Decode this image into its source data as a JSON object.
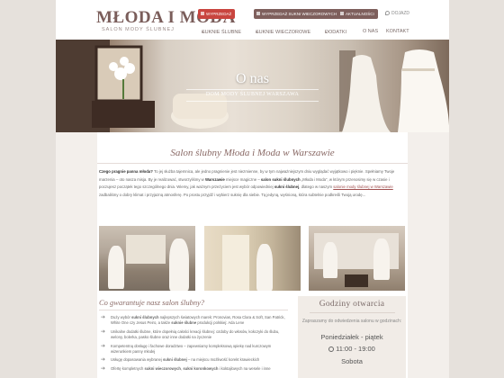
{
  "header": {
    "logo": "MŁODA I MODA",
    "tagline": "SALON MODY ŚLUBNEJ",
    "btn_sale": "WYPRZEDAŻ",
    "btn_evening_sale": "WYPRZEDAŻ SUKNI WIECZOROWYCH",
    "btn_news": "AKTUALNOŚCI",
    "location": "DOJAZD"
  },
  "nav": {
    "items": [
      {
        "label": "SUKNIE ŚLUBNE"
      },
      {
        "label": "SUKNIE WIECZOROWE"
      },
      {
        "label": "DODATKI"
      },
      {
        "label": "O NAS"
      },
      {
        "label": "KONTAKT"
      }
    ]
  },
  "hero": {
    "title": "O nas",
    "subtitle": "DOM MODY ŚLUBNEJ WARSZAWA"
  },
  "main": {
    "heading": "Salon ślubny Młoda i Moda w Warszawie",
    "paragraph": {
      "q": "Czego pragnie panna młoda?",
      "p1": " To jej służba tajemnica, ale jedno pragnienie jest niezmienne, by w tym najważniejszym dniu wyglądać wyjątkowo i pięknie. Spełniamy Twoje marzenia – oto nasza misja. By je realizować, stworzyliśmy w ",
      "warszawa": "Warszawie",
      "p2": " miejsce magiczne – ",
      "salon": "salon sukni ślubnych",
      "p3": " „Młoda i Moda”, w którym przenosimy się w czasie i poczujesz początek tego szczególnego dnia. Wiemy, jak ważnym przeżyciem jest wybór odpowiedniej ",
      "suknia": "sukni ślubnej",
      "p4": ", dlatego w naszym ",
      "link": "salonie mody ślubnej w Warszawie",
      "p5": " zadbaliśmy o dobry klimat i przyjazną atmosferę. Po prostu przyjdź i wybierz suknię dla siebie. Tą jedyną, wyśnioną, która subtelnie podkreśli Twoją urodę..."
    }
  },
  "guarantee": {
    "heading": "Co gwarantuje nasz salon ślubny?",
    "bullets": [
      {
        "a": "Duży wybór ",
        "b": "sukni ślubnych",
        "c": " najlepszych światowych marek: Pronovias, Rosa Clara & Soft, San Patrick, White One czy Jesus Peiro, a także ",
        "d": "suknie ślubne",
        "e": " produkcji polskiej: Ada Lene"
      },
      {
        "a": "Unikalne dodatki ślubne, które dopełnią całości kreacji ślubnej: ozdoby do włosów, kokczyki do ślubu, welony, bolerka, pasko ślubne oraz inne dodatki na życzenie",
        "b": "",
        "c": "",
        "d": "",
        "e": ""
      },
      {
        "a": "Kompetentną obsługę i fachowe doradztwo – zapewniamy kompleksową opiekę nad kurczowym wizerunkiem panny młodej",
        "b": "",
        "c": "",
        "d": "",
        "e": ""
      },
      {
        "a": "Usługę dopasowania wybranej ",
        "b": "sukni ślubnej",
        "c": " – na miejscu możliwość korekt krawieckich",
        "d": "",
        "e": ""
      },
      {
        "a": "Ofertę kompletnych ",
        "b": "sukni wieczorowych",
        "c": ", ",
        "d": "sukni koronkowych",
        "e": " i koktajlowych na wesele i inne"
      }
    ]
  },
  "hours": {
    "title": "Godziny otwarcia",
    "subtitle": "Zapraszamy do odwiedzenia salonu w godzinach:",
    "weekdays": "Poniedziałek - piątek",
    "weekday_time": "11:00 - 19:00",
    "saturday": "Sobota"
  }
}
